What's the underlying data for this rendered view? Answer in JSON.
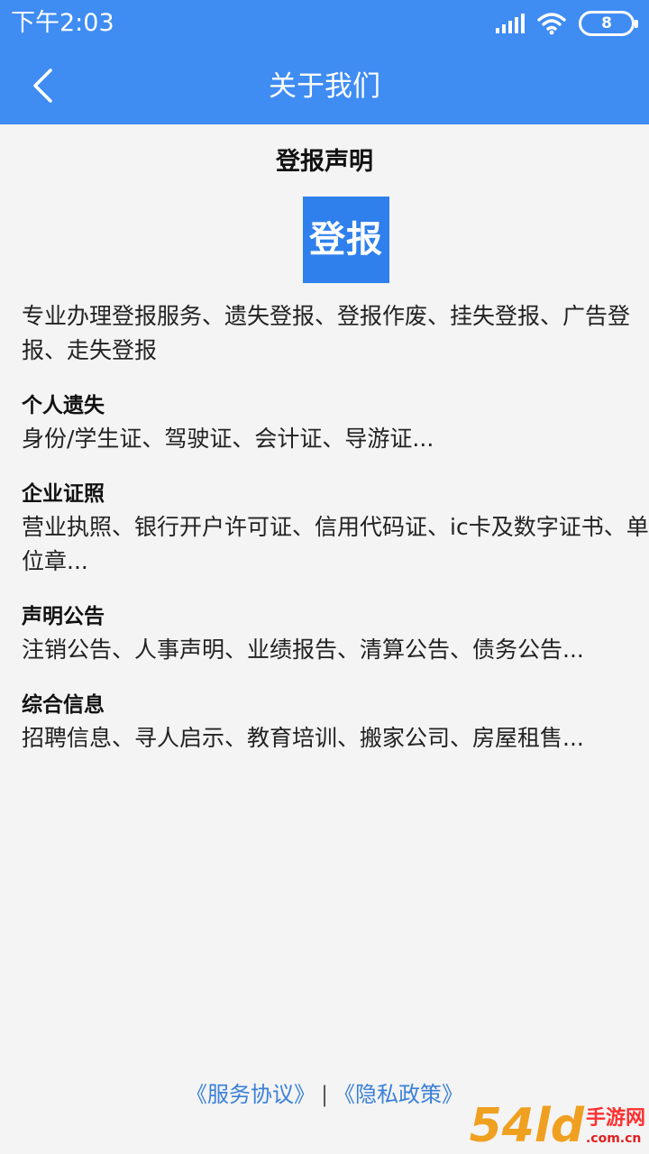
{
  "status_bar": {
    "time": "下午2:03",
    "battery": "8",
    "icons": [
      "signal-icon",
      "wifi-icon",
      "battery-icon"
    ]
  },
  "nav": {
    "title": "关于我们",
    "back_icon": "chevron-left-icon"
  },
  "page": {
    "heading": "登报声明",
    "logo_text": "登报",
    "intro": "专业办理登报服务、遗失登报、登报作废、挂失登报、广告登报、走失登报",
    "sections": [
      {
        "title": "个人遗失",
        "body": "身份/学生证、驾驶证、会计证、导游证..."
      },
      {
        "title": "企业证照",
        "body": "营业执照、银行开户许可证、信用代码证、ic卡及数字证书、单位章..."
      },
      {
        "title": "声明公告",
        "body": "注销公告、人事声明、业绩报告、清算公告、债务公告..."
      },
      {
        "title": "综合信息",
        "body": "招聘信息、寻人启示、教育培训、搬家公司、房屋租售..."
      }
    ]
  },
  "footer": {
    "service_agreement": "《服务协议》",
    "separator": "|",
    "privacy_policy": "《隐私政策》"
  },
  "watermark": {
    "brand": "54ld",
    "cn": "手游网",
    "url": ".com.cn"
  },
  "colors": {
    "header_bg": "#3f8cf3",
    "logo_bg": "#2f80ed",
    "link": "#3a80d8",
    "page_bg": "#f4f4f4"
  }
}
